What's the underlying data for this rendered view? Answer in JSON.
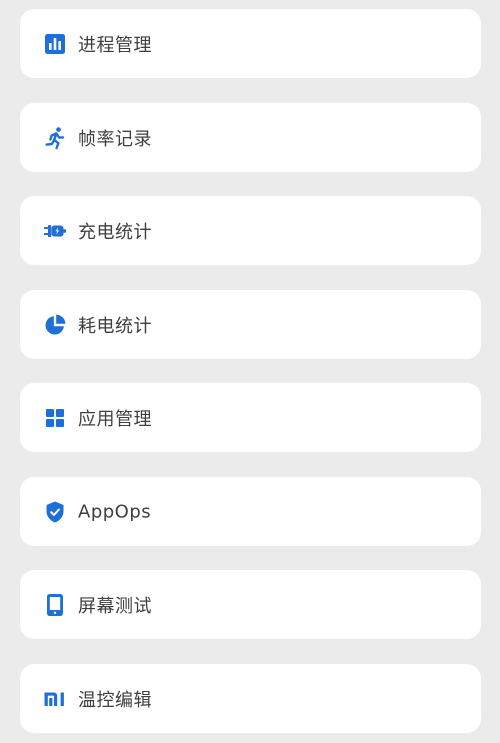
{
  "colors": {
    "background": "#ebebeb",
    "card": "#ffffff",
    "accent": "#1f6fd8",
    "text": "#3f3f3f"
  },
  "menu": {
    "items": [
      {
        "label": "进程管理",
        "icon": "bar-chart-icon"
      },
      {
        "label": "帧率记录",
        "icon": "running-icon"
      },
      {
        "label": "充电统计",
        "icon": "charging-plug-icon"
      },
      {
        "label": "耗电统计",
        "icon": "pie-chart-icon"
      },
      {
        "label": "应用管理",
        "icon": "grid-apps-icon"
      },
      {
        "label": "AppOps",
        "icon": "shield-check-icon"
      },
      {
        "label": "屏幕测试",
        "icon": "tablet-screen-icon"
      },
      {
        "label": "温控编辑",
        "icon": "mi-logo-icon"
      }
    ]
  }
}
